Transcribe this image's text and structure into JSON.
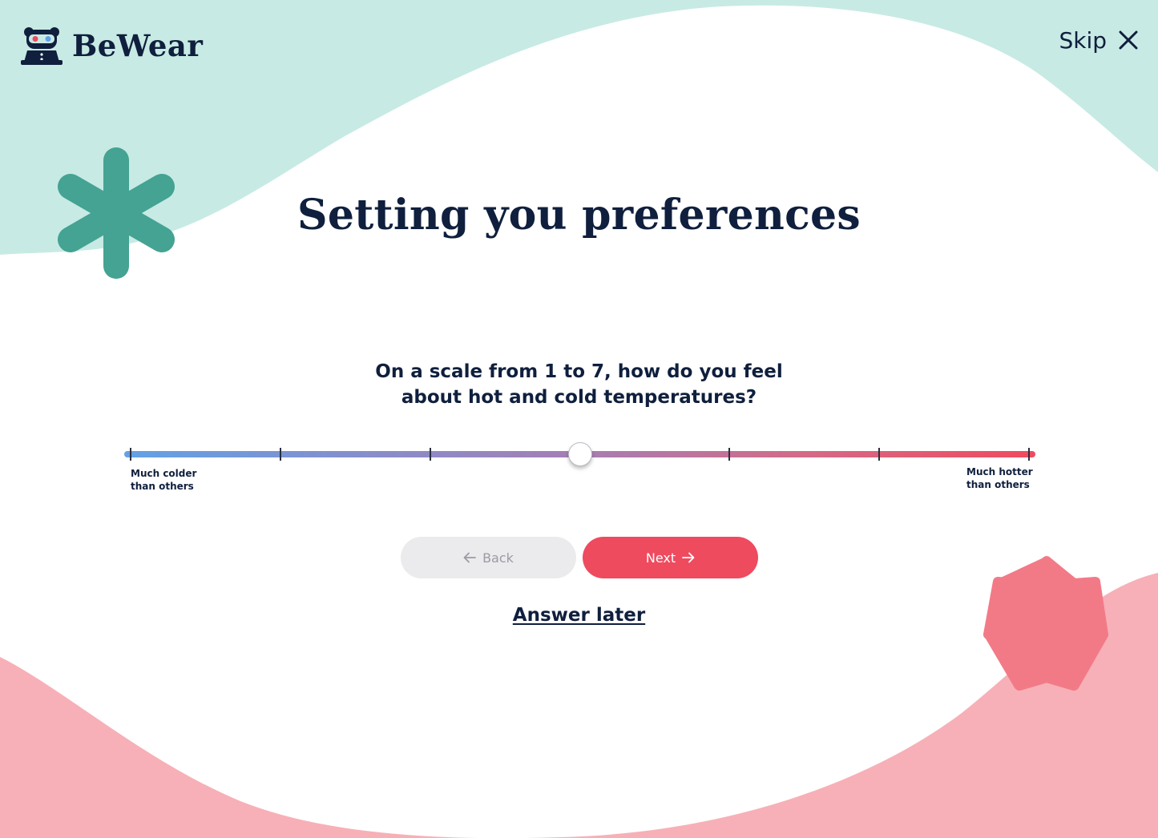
{
  "brand": {
    "name": "BeWear",
    "logo_icon": "bear-with-goggles-icon"
  },
  "header": {
    "skip_label": "Skip",
    "skip_icon": "close-icon"
  },
  "page": {
    "title": "Setting you preferences",
    "question_line1": "On a scale from 1 to 7, how do you feel",
    "question_line2": "about hot and cold temperatures?"
  },
  "slider": {
    "min": 1,
    "max": 7,
    "steps": [
      1,
      2,
      3,
      4,
      5,
      6,
      7
    ],
    "value": 4,
    "min_label_line1": "Much colder",
    "min_label_line2": "than others",
    "max_label_line1": "Much hotter",
    "max_label_line2": "than others",
    "gradient_colors": [
      "#62a1e6",
      "#a37fb6",
      "#d46a87",
      "#f04a5e"
    ]
  },
  "actions": {
    "back_label": "Back",
    "back_icon": "arrow-left-icon",
    "next_label": "Next",
    "next_icon": "arrow-right-icon",
    "answer_later_label": "Answer later"
  },
  "decorations": {
    "asterisk_icon": "asterisk-icon",
    "star_icon": "star-badge-icon"
  },
  "colors": {
    "primary": "#ee4b5f",
    "navy": "#0f1f3d",
    "mint": "#c8eae4",
    "teal": "#44a393",
    "pink_wave": "#f7b0b7",
    "pink_star": "#f27a87",
    "disabled": "#ebebed"
  }
}
